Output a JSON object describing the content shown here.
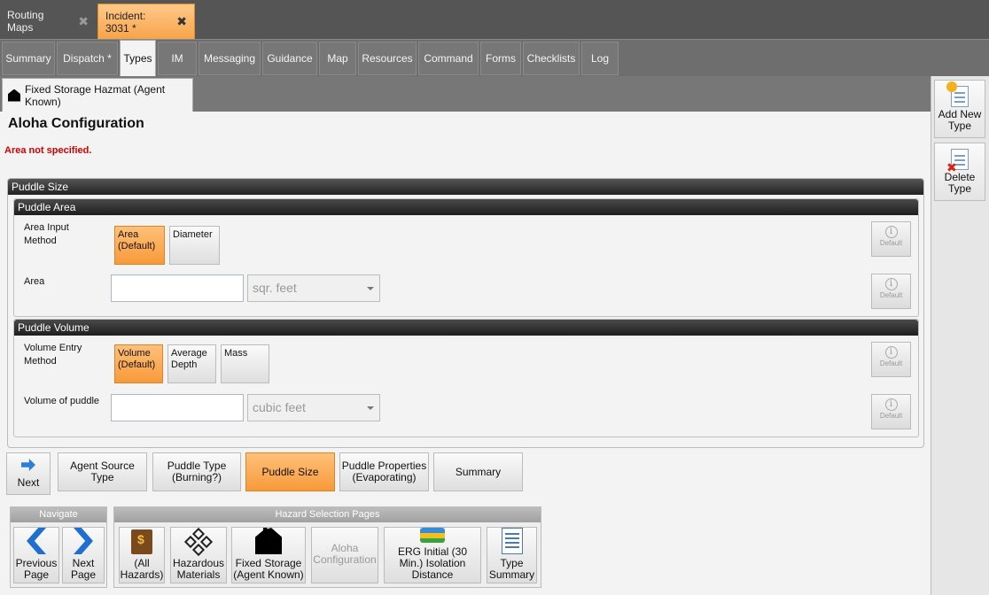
{
  "doc_tabs": [
    {
      "label": "Routing Maps",
      "close": "✖"
    },
    {
      "label": "Incident: 3031 *",
      "close": "✖"
    }
  ],
  "section_tabs": [
    "Summary",
    "Dispatch *",
    "Types",
    "IM",
    "Messaging",
    "Guidance",
    "Map",
    "Resources",
    "Command",
    "Forms",
    "Checklists",
    "Log"
  ],
  "type_tab": {
    "label": "Fixed Storage Hazmat (Agent Known)",
    "icon": "house-icon"
  },
  "page": {
    "title": "Aloha Configuration",
    "error": "Area not specified."
  },
  "puddle_size": {
    "header": "Puddle Size",
    "area": {
      "header": "Puddle Area",
      "input_method_label": "Area Input Method",
      "choices": [
        "Area (Default)",
        "Diameter"
      ],
      "selected": "Area (Default)",
      "area_label": "Area",
      "area_value": "",
      "area_unit": "sqr. feet",
      "default_label": "Default"
    },
    "volume": {
      "header": "Puddle Volume",
      "entry_method_label": "Volume Entry Method",
      "choices": [
        "Volume (Default)",
        "Average Depth",
        "Mass"
      ],
      "selected": "Volume (Default)",
      "volume_label": "Volume of puddle",
      "volume_value": "",
      "volume_unit": "cubic feet",
      "default_label": "Default"
    }
  },
  "wizard": {
    "next_label": "Next",
    "steps": [
      "Agent Source Type",
      "Puddle Type (Burning?)",
      "Puddle Size",
      "Puddle Properties (Evaporating)",
      "Summary"
    ],
    "active_step": "Puddle Size"
  },
  "navigate": {
    "header": "Navigate",
    "previous": "Previous Page",
    "next": "Next Page"
  },
  "hazard_pages": {
    "header": "Hazard Selection Pages",
    "buttons": [
      "(All Hazards)",
      "Hazardous Materials",
      "Fixed Storage (Agent Known)",
      "Aloha Configuration",
      "ERG Initial (30 Min.) Isolation Distance",
      "Type Summary"
    ],
    "disabled": "Aloha Configuration"
  },
  "right_panel": {
    "add": "Add New Type",
    "delete": "Delete Type"
  },
  "colors": {
    "accent": "#f79a3a",
    "error": "#d00000",
    "tab_bg": "#6e6e6e"
  }
}
